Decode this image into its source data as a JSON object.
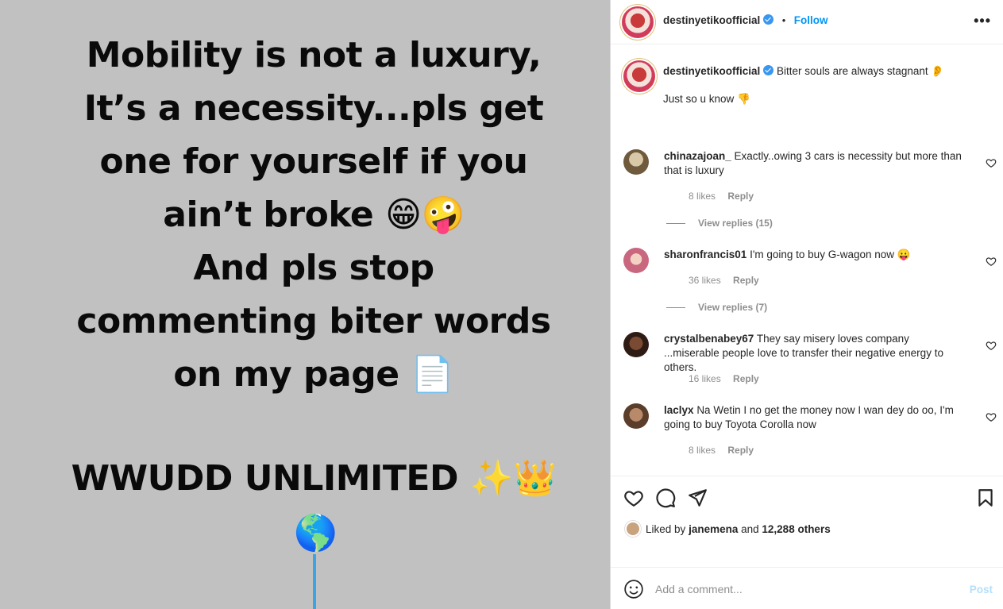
{
  "image": {
    "lines": [
      "Mobility is not a luxury,",
      "It’s a necessity...pls get",
      "one for yourself if you",
      "ain’t broke 😁🤪",
      "And pls stop",
      "commenting biter words",
      "on my page 📄"
    ],
    "signature": "WWUDD UNLIMITED ✨👑",
    "globe": "🌎"
  },
  "header": {
    "username": "destinyetikoofficial",
    "dot": "•",
    "follow_label": "Follow",
    "more_label": "•••"
  },
  "caption": {
    "username": "destinyetikoofficial",
    "text": "Bitter souls are always stagnant 👂",
    "second_line": "Just so u know 👎"
  },
  "comments": [
    {
      "username": "chinazajoan_",
      "text": "Exactly..owing 3 cars is necessity but more than that is luxury",
      "likes": "8 likes",
      "reply_label": "Reply",
      "view_replies": "View replies (15)"
    },
    {
      "username": "sharonfrancis01",
      "text": "I'm going to buy G-wagon now 😛",
      "likes": "36 likes",
      "reply_label": "Reply",
      "view_replies": "View replies (7)"
    },
    {
      "username": "crystalbenabey67",
      "text": "They say misery loves company ...miserable people love to transfer their negative energy to others.",
      "likes": "16 likes",
      "reply_label": "Reply"
    },
    {
      "username": "laclyx",
      "text": "Na Wetin I no get the money now I wan dey do oo, I'm going to buy Toyota Corolla now",
      "likes": "8 likes",
      "reply_label": "Reply"
    }
  ],
  "actions": {
    "liked_by_prefix": "Liked by",
    "liked_by_user": "janemena",
    "liked_by_and": "and",
    "liked_by_others": "12,288 others"
  },
  "add_comment": {
    "placeholder": "Add a comment...",
    "post_label": "Post"
  },
  "colors": {
    "accent": "#0095f6",
    "image_bg": "#c1c1c1",
    "muted": "#8e8e8e"
  }
}
